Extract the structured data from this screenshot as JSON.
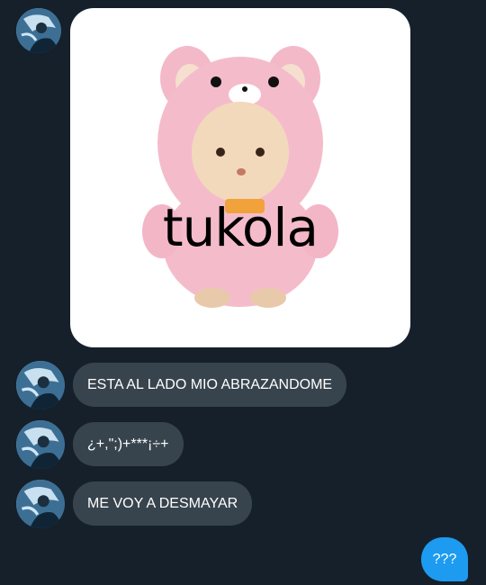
{
  "thread": {
    "image_caption": "tukola",
    "messages": [
      {
        "text": "ESTA AL LADO MIO ABRAZANDOME",
        "from": "other"
      },
      {
        "text": "¿+,\";)+***¡÷+",
        "from": "other"
      },
      {
        "text": "ME VOY A DESMAYAR",
        "from": "other"
      },
      {
        "text": "???",
        "from": "me"
      }
    ]
  },
  "colors": {
    "background": "#15202b",
    "incoming_bubble": "#38444d",
    "outgoing_bubble": "#1d9bf0",
    "text": "#ffffff"
  },
  "icons": {
    "image_subject": "pink-bear-costume-plush-icon",
    "avatar": "user-avatar"
  }
}
